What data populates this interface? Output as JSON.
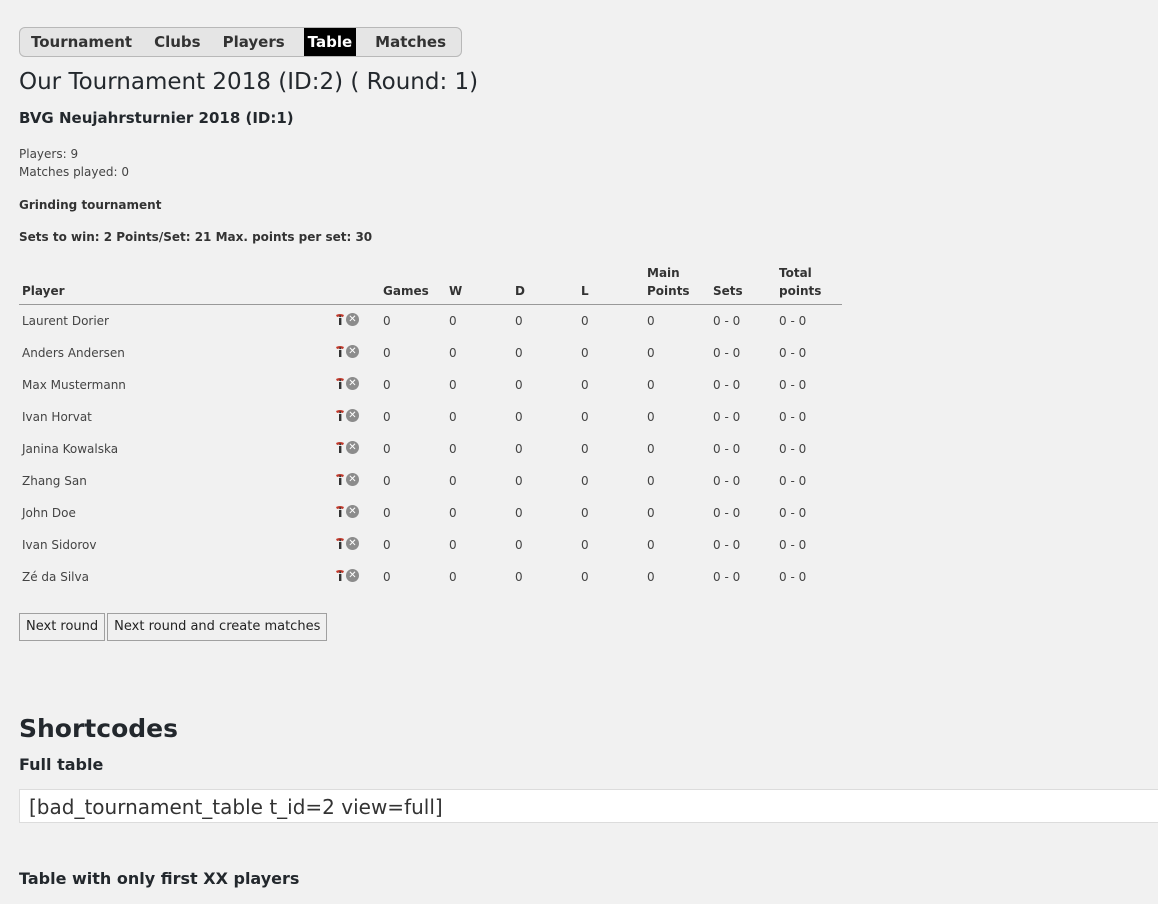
{
  "tabs": [
    {
      "label": "Tournament",
      "active": false
    },
    {
      "label": "Clubs",
      "active": false
    },
    {
      "label": "Players",
      "active": false
    },
    {
      "label": "Table",
      "active": true
    },
    {
      "label": "Matches",
      "active": false
    }
  ],
  "title": "Our Tournament 2018 (ID:2) ( Round: 1)",
  "subtitle": "BVG Neujahrsturnier 2018 (ID:1)",
  "players_count": "Players: 9",
  "matches_played": "Matches played: 0",
  "tournament_type": "Grinding tournament",
  "rules": "Sets to win: 2 Points/Set: 21 Max. points per set: 30",
  "table": {
    "headers": {
      "player": "Player",
      "games": "Games",
      "w": "W",
      "d": "D",
      "l": "L",
      "main_points_1": "Main",
      "main_points_2": "Points",
      "sets": "Sets",
      "total_points_1": "Total",
      "total_points_2": "points"
    },
    "rows": [
      {
        "player": "Laurent Dorier",
        "games": "0",
        "w": "0",
        "d": "0",
        "l": "0",
        "main": "0",
        "sets": "0 - 0",
        "total": "0 - 0"
      },
      {
        "player": "Anders Andersen",
        "games": "0",
        "w": "0",
        "d": "0",
        "l": "0",
        "main": "0",
        "sets": "0 - 0",
        "total": "0 - 0"
      },
      {
        "player": "Max Mustermann",
        "games": "0",
        "w": "0",
        "d": "0",
        "l": "0",
        "main": "0",
        "sets": "0 - 0",
        "total": "0 - 0"
      },
      {
        "player": "Ivan Horvat",
        "games": "0",
        "w": "0",
        "d": "0",
        "l": "0",
        "main": "0",
        "sets": "0 - 0",
        "total": "0 - 0"
      },
      {
        "player": "Janina Kowalska",
        "games": "0",
        "w": "0",
        "d": "0",
        "l": "0",
        "main": "0",
        "sets": "0 - 0",
        "total": "0 - 0"
      },
      {
        "player": "Zhang San",
        "games": "0",
        "w": "0",
        "d": "0",
        "l": "0",
        "main": "0",
        "sets": "0 - 0",
        "total": "0 - 0"
      },
      {
        "player": "John Doe",
        "games": "0",
        "w": "0",
        "d": "0",
        "l": "0",
        "main": "0",
        "sets": "0 - 0",
        "total": "0 - 0"
      },
      {
        "player": "Ivan Sidorov",
        "games": "0",
        "w": "0",
        "d": "0",
        "l": "0",
        "main": "0",
        "sets": "0 - 0",
        "total": "0 - 0"
      },
      {
        "player": "Zé da Silva",
        "games": "0",
        "w": "0",
        "d": "0",
        "l": "0",
        "main": "0",
        "sets": "0 - 0",
        "total": "0 - 0"
      }
    ],
    "row_icons": [
      "info-icon",
      "delete-icon"
    ]
  },
  "buttons": {
    "next_round": "Next round",
    "next_round_create": "Next round and create matches"
  },
  "shortcodes": {
    "heading": "Shortcodes",
    "full_table_label": "Full table",
    "full_table_code": "[bad_tournament_table t_id=2 view=full]",
    "first_xx_label": "Table with only first XX players"
  },
  "colors": {
    "active_tab_bg": "#000000",
    "page_bg": "#f1f1f1",
    "info_icon_red": "#c0392b",
    "delete_icon_gray": "#8c8c8c"
  }
}
